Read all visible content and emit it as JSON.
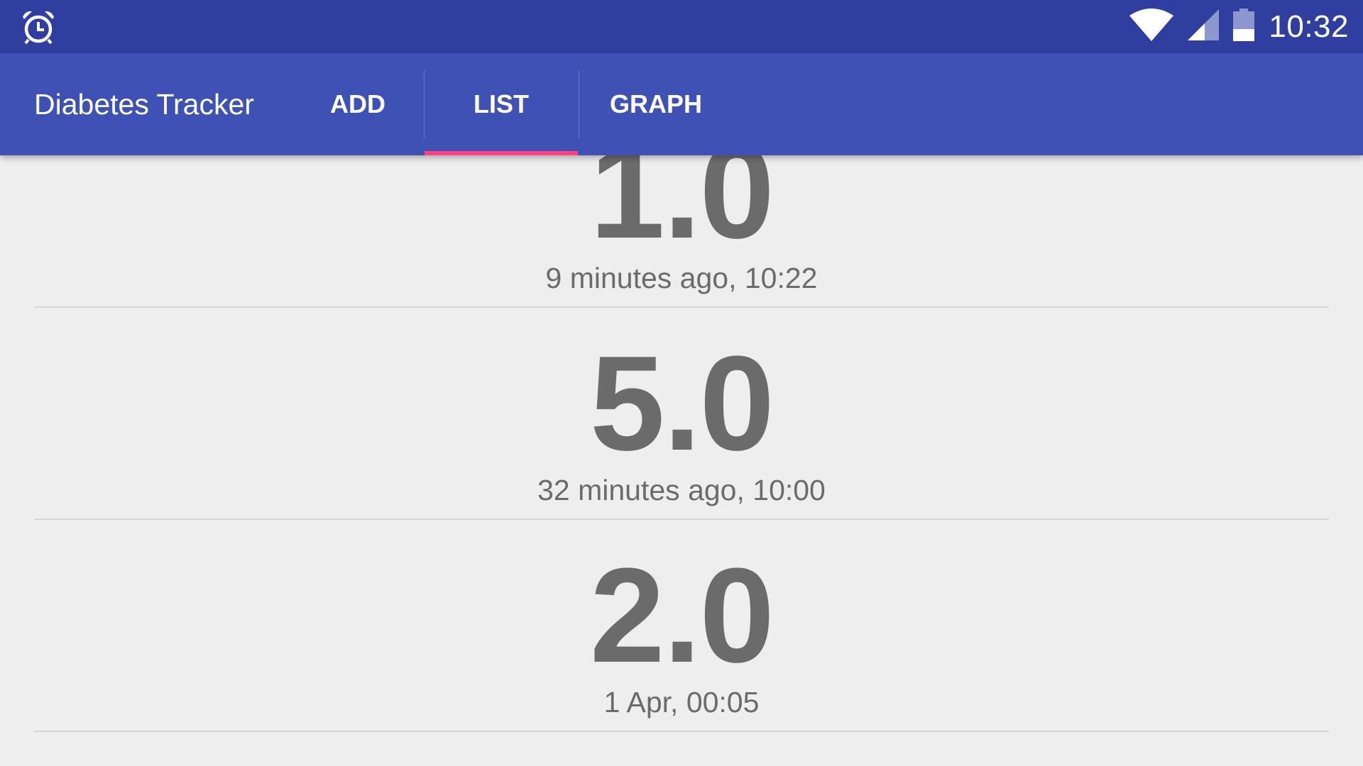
{
  "status_bar": {
    "time": "10:32",
    "icons": [
      "alarm-clock-icon",
      "wifi-icon",
      "cell-signal-icon",
      "battery-icon"
    ]
  },
  "app_bar": {
    "title": "Diabetes Tracker",
    "tabs": [
      {
        "label": "ADD",
        "selected": false
      },
      {
        "label": "LIST",
        "selected": true
      },
      {
        "label": "GRAPH",
        "selected": false
      }
    ]
  },
  "entries": [
    {
      "value": "1.0",
      "time": "9 minutes ago, 10:22"
    },
    {
      "value": "5.0",
      "time": "32 minutes ago, 10:00"
    },
    {
      "value": "2.0",
      "time": "1 Apr, 00:05"
    }
  ],
  "colors": {
    "status_bar": "#303f9f",
    "app_bar": "#3f51b5",
    "tab_indicator": "#ff4081",
    "background": "#eeeeee",
    "text": "#6b6b6b"
  }
}
